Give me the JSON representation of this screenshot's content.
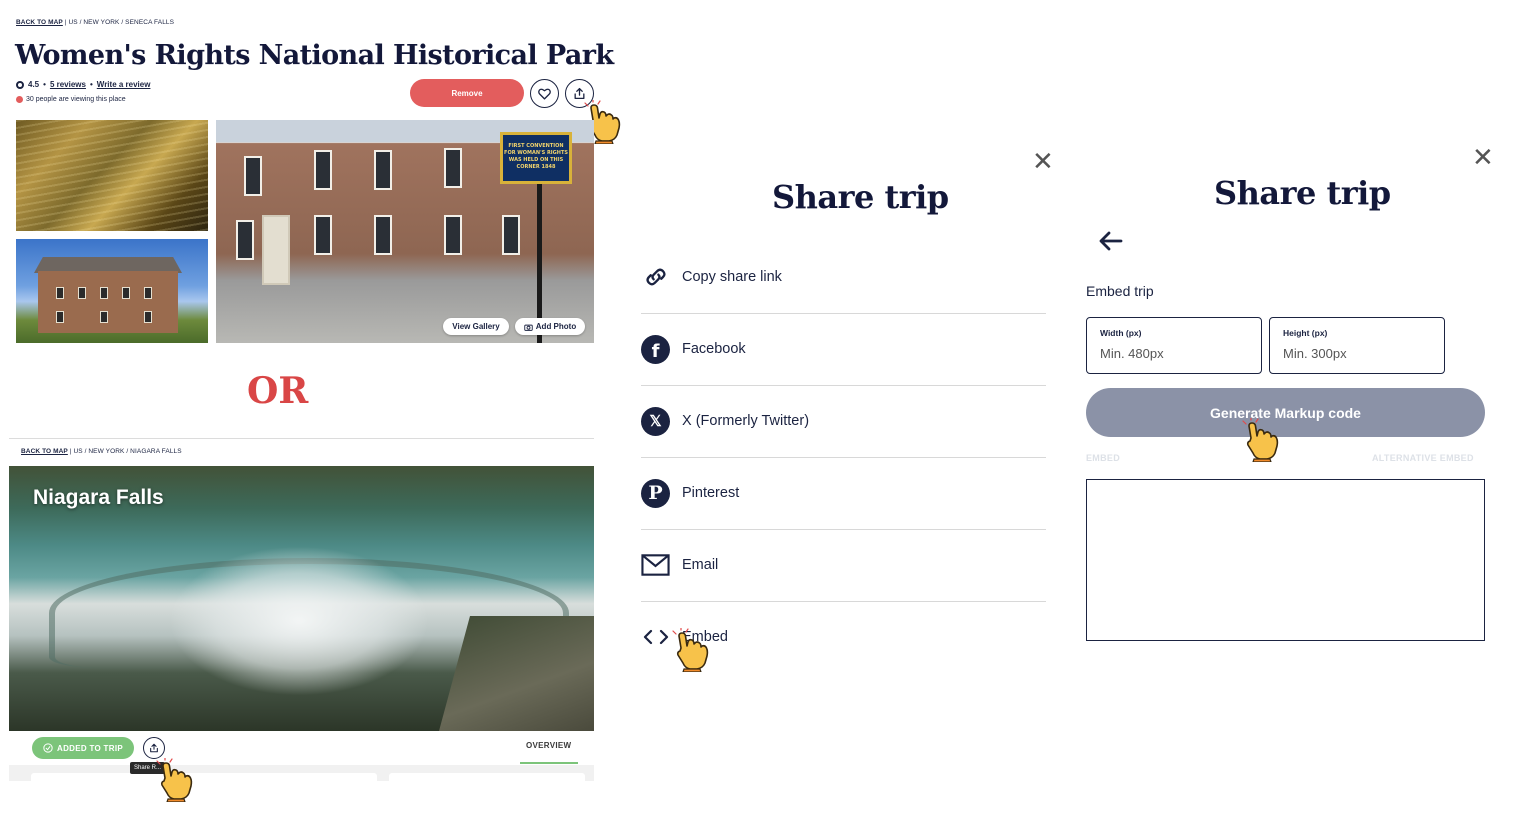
{
  "park": {
    "breadcrumb_link": "BACK TO MAP",
    "breadcrumb_path": " | US / NEW YORK / SENECA FALLS",
    "title": "Women's Rights National Historical Park",
    "rating": "4.5",
    "reviews_link": "5 reviews",
    "write_review_link": "Write a review",
    "viewing_text": "30 people are viewing this place",
    "remove_label": "Remove",
    "view_gallery_label": "View Gallery",
    "add_photo_label": "Add Photo",
    "sign_text": "FIRST CONVENTION FOR WOMAN'S RIGHTS WAS HELD ON THIS CORNER 1848"
  },
  "or_text": "OR",
  "niagara": {
    "breadcrumb_link": "BACK TO MAP",
    "breadcrumb_path": " | US / NEW YORK / NIAGARA FALLS",
    "title": "Niagara Falls",
    "added_label": "ADDED TO TRIP",
    "tooltip": "Share R...",
    "overview_tab": "OVERVIEW"
  },
  "share_modal": {
    "close": "✕",
    "title": "Share trip",
    "options": [
      {
        "label": "Copy share link",
        "icon": "link-icon"
      },
      {
        "label": "Facebook",
        "icon": "facebook-icon"
      },
      {
        "label": "X (Formerly Twitter)",
        "icon": "x-twitter-icon"
      },
      {
        "label": "Pinterest",
        "icon": "pinterest-icon"
      },
      {
        "label": "Email",
        "icon": "email-icon"
      },
      {
        "label": "Embed",
        "icon": "code-icon"
      }
    ]
  },
  "embed_modal": {
    "close": "✕",
    "title": "Share trip",
    "back_icon": "arrow-left-icon",
    "section_label": "Embed trip",
    "width_label": "Width (px)",
    "width_placeholder": "Min. 480px",
    "height_label": "Height (px)",
    "height_placeholder": "Min. 300px",
    "generate_label": "Generate Markup code",
    "tab_embed": "EMBED",
    "tab_alternative": "ALTERNATIVE EMBED"
  },
  "colors": {
    "navy": "#1b2341",
    "remove_red": "#e35d5d",
    "or_red": "#d94646",
    "added_green": "#7cc47a",
    "generate_gray": "#8b92a7"
  }
}
